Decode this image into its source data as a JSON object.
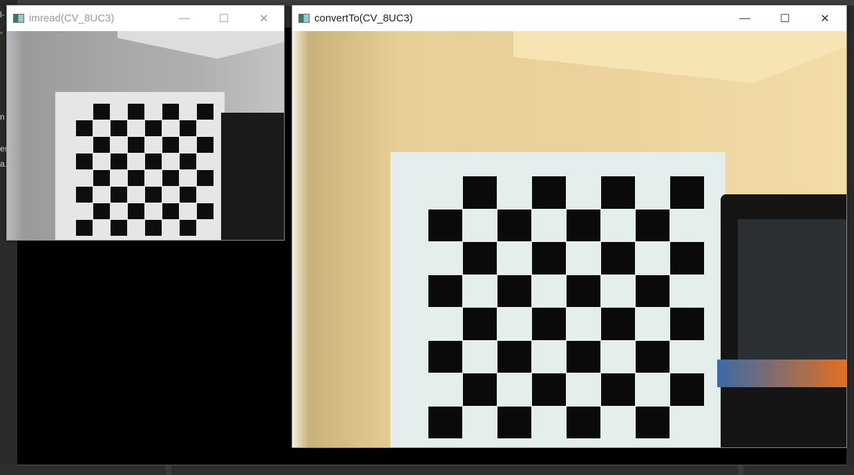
{
  "ide": {
    "left_fragments": [
      "l-",
      "”",
      "n",
      "er",
      "a."
    ]
  },
  "windows": [
    {
      "title": "imread(CV_8UC3)",
      "active": false,
      "controls": {
        "minimize": "—",
        "maximize": "☐",
        "close": "✕"
      }
    },
    {
      "title": "convertTo(CV_8UC3)",
      "active": true,
      "controls": {
        "minimize": "—",
        "maximize": "☐",
        "close": "✕"
      }
    }
  ]
}
